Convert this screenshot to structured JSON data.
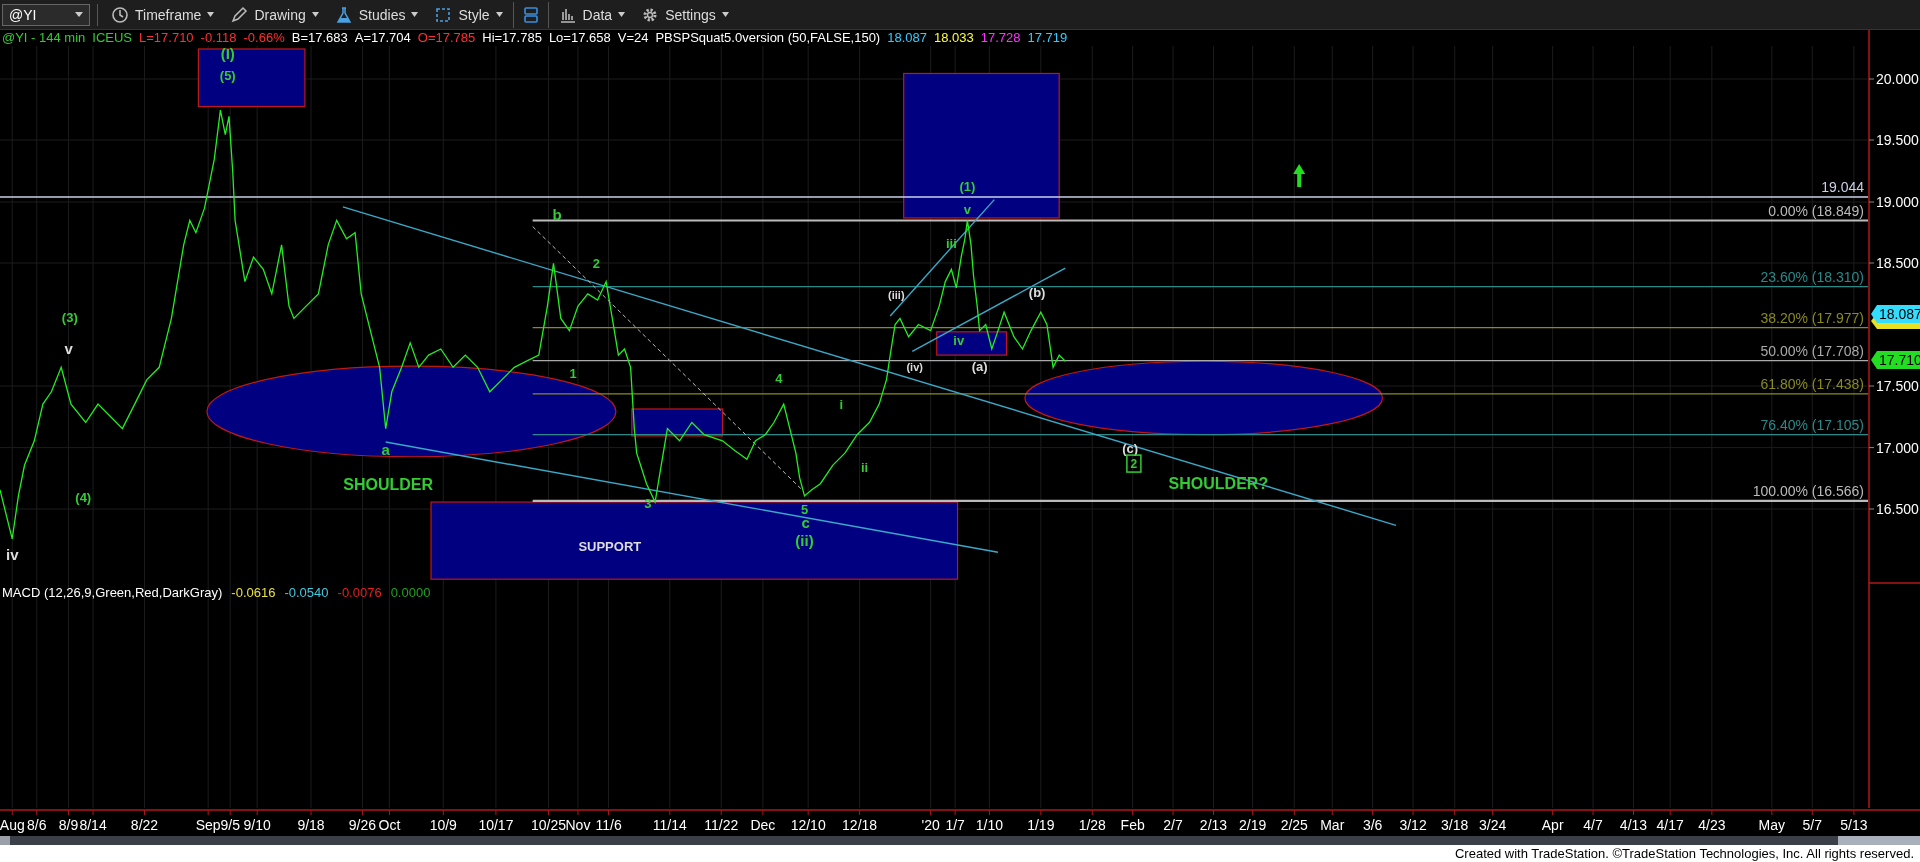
{
  "toolbar": {
    "symbol": "@YI",
    "buttons": [
      {
        "label": "Timeframe",
        "kind": "clock"
      },
      {
        "label": "Drawing",
        "kind": "pen"
      },
      {
        "label": "Studies",
        "kind": "flask"
      },
      {
        "label": "Style",
        "kind": "frame"
      },
      {
        "kind": "layout"
      },
      {
        "label": "Data",
        "kind": "bars"
      },
      {
        "label": "Settings",
        "kind": "gear"
      }
    ]
  },
  "header": [
    {
      "text": "@YI - 144 min",
      "color": "#33cc33"
    },
    {
      "text": "ICEUS",
      "color": "#33cc33"
    },
    {
      "text": "L=17.710",
      "color": "#ff3030"
    },
    {
      "text": "-0.118",
      "color": "#ff3030"
    },
    {
      "text": "-0.66%",
      "color": "#ff3030"
    },
    {
      "text": "B=17.683",
      "color": "#ffffff"
    },
    {
      "text": "A=17.704",
      "color": "#ffffff"
    },
    {
      "text": "O=17.785",
      "color": "#ff3030"
    },
    {
      "text": "Hi=17.785",
      "color": "#ffffff"
    },
    {
      "text": "Lo=17.658",
      "color": "#ffffff"
    },
    {
      "text": "V=24",
      "color": "#ffffff"
    },
    {
      "text": "PBSPSquat5.0version (50,FALSE,150)",
      "color": "#ffffff"
    },
    {
      "text": "18.087",
      "color": "#33ccff"
    },
    {
      "text": "18.033",
      "color": "#ffff33"
    },
    {
      "text": "17.728",
      "color": "#ff33ff"
    },
    {
      "text": "17.719",
      "color": "#33ccff"
    }
  ],
  "annotations": [
    {
      "text": "(I)",
      "color": "#33cc33",
      "kind": "major"
    },
    {
      "text": "(5)",
      "color": "#33cc33",
      "kind": "wave"
    },
    {
      "text": "(3)",
      "color": "#33cc33",
      "kind": "wave"
    },
    {
      "text": "v",
      "color": "#dddddd",
      "kind": "major"
    },
    {
      "text": "(4)",
      "color": "#33cc33",
      "kind": "wave"
    },
    {
      "text": "iv",
      "color": "#dddddd",
      "kind": "major"
    },
    {
      "text": "a",
      "color": "#33cc33",
      "kind": "major"
    },
    {
      "text": "SHOULDER",
      "color": "#33cc33",
      "kind": "heading"
    },
    {
      "text": "b",
      "color": "#33cc33",
      "kind": "major"
    },
    {
      "text": "2",
      "color": "#33cc33",
      "kind": "wave"
    },
    {
      "text": "1",
      "color": "#33cc33",
      "kind": "wave"
    },
    {
      "text": "3",
      "color": "#33cc33",
      "kind": "wave"
    },
    {
      "text": "4",
      "color": "#33cc33",
      "kind": "wave"
    },
    {
      "text": "5",
      "color": "#33cc33",
      "kind": "wave"
    },
    {
      "text": "c",
      "color": "#33cc33",
      "kind": "major"
    },
    {
      "text": "(ii)",
      "color": "#33cc33",
      "kind": "major"
    },
    {
      "text": "i",
      "color": "#33cc33",
      "kind": "wave"
    },
    {
      "text": "ii",
      "color": "#33cc33",
      "kind": "wave"
    },
    {
      "text": "(iii)",
      "color": "#dddddd",
      "kind": "small"
    },
    {
      "text": "iii",
      "color": "#33cc33",
      "kind": "wave"
    },
    {
      "text": "v",
      "color": "#33cc33",
      "kind": "wave"
    },
    {
      "text": "(1)",
      "color": "#33cc33",
      "kind": "wave"
    },
    {
      "text": "iv",
      "color": "#33cc33",
      "kind": "wave"
    },
    {
      "text": "(iv)",
      "color": "#dddddd",
      "kind": "small"
    },
    {
      "text": "(a)",
      "color": "#dddddd",
      "kind": "wave"
    },
    {
      "text": "(b)",
      "color": "#dddddd",
      "kind": "wave"
    },
    {
      "text": "(c)",
      "color": "#dddddd",
      "kind": "wave"
    },
    {
      "text": "2",
      "color": "#33cc33",
      "kind": "boxed"
    },
    {
      "text": "SHOULDER?",
      "color": "#33cc33",
      "kind": "heading"
    },
    {
      "text": "SUPPORT",
      "color": "#dddddd",
      "kind": "wave"
    }
  ],
  "fib_levels": [
    {
      "text": "19.044",
      "color": "#c8d0e8"
    },
    {
      "text": "0.00% (18.849)",
      "color": "#bbbbbb"
    },
    {
      "text": "23.60% (18.310)",
      "color": "#2a8a8a"
    },
    {
      "text": "38.20% (17.977)",
      "color": "#8a8a20"
    },
    {
      "text": "50.00% (17.708)",
      "color": "#aaaaaa"
    },
    {
      "text": "61.80% (17.438)",
      "color": "#8a8a20"
    },
    {
      "text": "76.40% (17.105)",
      "color": "#2a8a8a"
    },
    {
      "text": "100.00% (16.566)",
      "color": "#bbbbbb"
    }
  ],
  "price_axis": [
    "20.000",
    "19.500",
    "19.000",
    "18.500",
    "17.500",
    "17.000",
    "16.500"
  ],
  "price_tags": [
    {
      "text": "18.087",
      "color": "#33ddff"
    },
    {
      "text": "17.710",
      "color": "#22dd22"
    }
  ],
  "macd": [
    {
      "text": "MACD (12,26,9,Green,Red,DarkGray)",
      "color": "#ffffff"
    },
    {
      "text": "-0.0616",
      "color": "#e8e040"
    },
    {
      "text": "-0.0540",
      "color": "#40c8e0"
    },
    {
      "text": "-0.0076",
      "color": "#e02020"
    },
    {
      "text": "0.0000",
      "color": "#20a020"
    }
  ],
  "date_axis": [
    "Aug",
    "8/6",
    "8/9",
    "8/14",
    "8/22",
    "Sep",
    "9/5",
    "9/10",
    "9/18",
    "9/26",
    "Oct",
    "10/9",
    "10/17",
    "10/25",
    "Nov",
    "11/6",
    "11/14",
    "11/22",
    "Dec",
    "12/10",
    "12/18",
    "'20",
    "1/7",
    "1/10",
    "1/19",
    "1/28",
    "Feb",
    "2/7",
    "2/13",
    "2/19",
    "2/25",
    "Mar",
    "3/6",
    "3/12",
    "3/18",
    "3/24",
    "Apr",
    "4/7",
    "4/13",
    "4/17",
    "4/23",
    "May",
    "5/7",
    "5/13"
  ],
  "footer": "Created with TradeStation. ©TradeStation Technologies, Inc. All rights reserved."
}
